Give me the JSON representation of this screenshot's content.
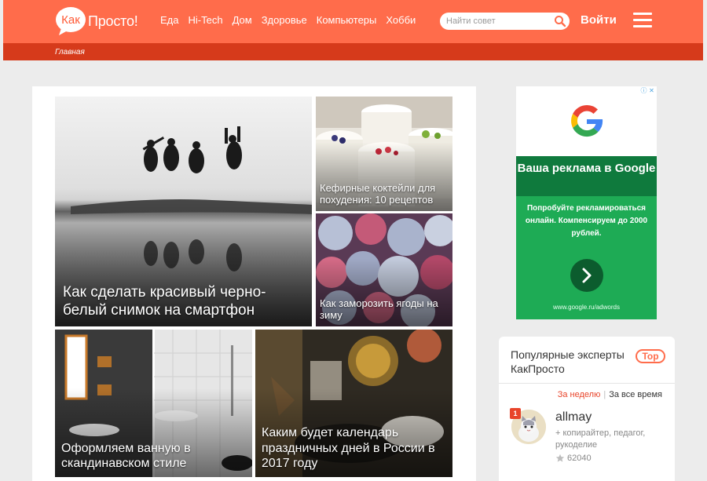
{
  "header": {
    "logo_part1": "Как",
    "logo_part2": "Просто!",
    "nav": [
      "Еда",
      "Hi-Tech",
      "Дом",
      "Здоровье",
      "Компьютеры",
      "Хобби"
    ],
    "search_placeholder": "Найти совет",
    "login_label": "Войти",
    "brand_color": "#ff6c4b",
    "subbar_color": "#d63a1b"
  },
  "breadcrumb": "Главная",
  "articles": [
    {
      "title": "Как сделать красивый черно-белый снимок на смартфон"
    },
    {
      "title": "Кефирные коктейли для похудения: 10 рецептов"
    },
    {
      "title": "Как заморозить ягоды на зиму"
    },
    {
      "title": "Оформляем ванную в скандинавском стиле"
    },
    {
      "title": "Каким будет календарь праздничных дней в России в 2017 году"
    }
  ],
  "ad": {
    "headline": "Ваша реклама в Google",
    "text": "Попробуйте рекламироваться онлайн. Компенсируем до 2000 рублей.",
    "url": "www.google.ru/adwords"
  },
  "experts": {
    "title": "Популярные эксперты КакПросто",
    "badge": "Top",
    "period_week": "За неделю",
    "period_all": "За все время",
    "list": [
      {
        "rank": "1",
        "name": "allmay",
        "desc": "+ копирайтер, педагог, рукоделие",
        "score": "62040"
      }
    ]
  }
}
